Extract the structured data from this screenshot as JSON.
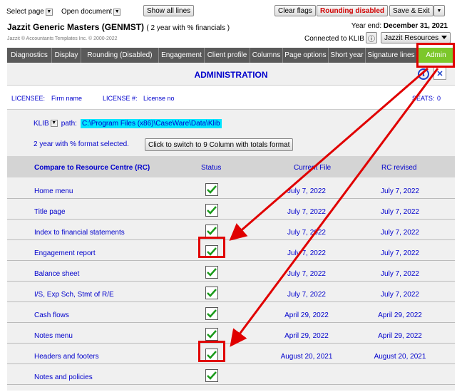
{
  "toolbar": {
    "select_page": "Select page",
    "open_document": "Open document",
    "show_all_lines": "Show all lines",
    "clear_flags": "Clear flags",
    "rounding_disabled": "Rounding disabled",
    "save_exit": "Save & Exit"
  },
  "header": {
    "title": "Jazzit Generic Masters (GENMST)",
    "subtitle": "( 2 year with % financials )",
    "year_end_label": "Year end:",
    "year_end_date": "December 31, 2021",
    "copyright": "Jazzit ® Accountants Templates Inc. © 2000-2022",
    "connected": "Connected to KLIB",
    "info_button": "ⓘ",
    "resources": "Jazzit Resources"
  },
  "tabs": [
    {
      "label": "Diagnostics"
    },
    {
      "label": "Display"
    },
    {
      "label": "Rounding (Disabled)"
    },
    {
      "label": "Engagement"
    },
    {
      "label": "Client profile"
    },
    {
      "label": "Columns"
    },
    {
      "label": "Page options"
    },
    {
      "label": "Short year"
    },
    {
      "label": "Signature lines"
    },
    {
      "label": "Admin"
    }
  ],
  "admin": {
    "title": "ADMINISTRATION",
    "info_icon": "i",
    "close_icon": "✕",
    "licensee_label": "LICENSEE:",
    "licensee_value": "Firm name",
    "license_label": "LICENSE #:",
    "license_value": "License no",
    "seats_label": "SEATS:",
    "seats_value": "0",
    "klib_label": "KLIB",
    "path_label": "path:",
    "path_value": "C:\\Program Files (x86)\\CaseWare\\Data\\Klib",
    "format_text": "2 year with % format selected.",
    "switch_button": "Click to switch to 9 Column with totals format"
  },
  "table": {
    "headers": [
      "Compare to Resource Centre (RC)",
      "Status",
      "Current File",
      "RC revised"
    ],
    "rows": [
      {
        "name": "Home menu",
        "current": "July 7, 2022",
        "rc": "July 7, 2022"
      },
      {
        "name": "Title page",
        "current": "July 7, 2022",
        "rc": "July 7, 2022"
      },
      {
        "name": "Index to financial statements",
        "current": "July 7, 2022",
        "rc": "July 7, 2022"
      },
      {
        "name": "Engagement report",
        "current": "July 7, 2022",
        "rc": "July 7, 2022"
      },
      {
        "name": "Balance sheet",
        "current": "July 7, 2022",
        "rc": "July 7, 2022"
      },
      {
        "name": "I/S, Exp Sch, Stmt of R/E",
        "current": "July 7, 2022",
        "rc": "July 7, 2022"
      },
      {
        "name": "Cash flows",
        "current": "April 29, 2022",
        "rc": "April 29, 2022"
      },
      {
        "name": "Notes menu",
        "current": "April 29, 2022",
        "rc": "April 29, 2022"
      },
      {
        "name": "Headers and footers",
        "current": "August 20, 2021",
        "rc": "August 20, 2021"
      },
      {
        "name": "Notes and policies",
        "current": "",
        "rc": ""
      }
    ]
  },
  "colors": {
    "accent_blue": "#0000cc",
    "admin_tab": "#7cc72a",
    "highlight": "#e00000",
    "checkmark": "#1a9a1a"
  }
}
